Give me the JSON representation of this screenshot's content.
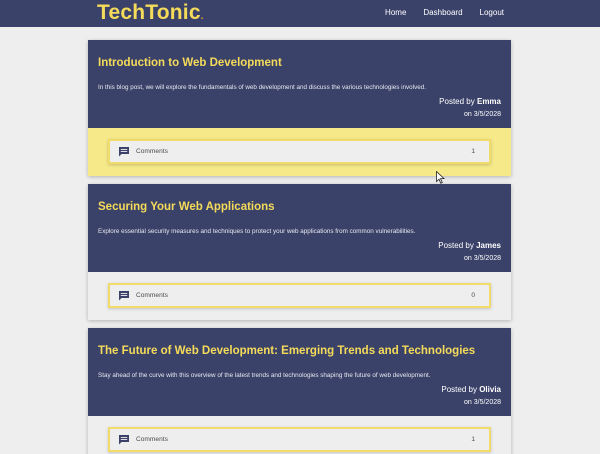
{
  "nav": {
    "brand": "TechTonic",
    "brand_dot": ".",
    "links": [
      "Home",
      "Dashboard",
      "Logout"
    ]
  },
  "posts": [
    {
      "title": "Introduction to Web Development",
      "description": "In this blog post, we will explore the fundamentals of web development and discuss the various technologies involved.",
      "posted_by_prefix": "Posted by",
      "author": "Emma",
      "date": "on 3/5/2028",
      "comments_label": "Comments",
      "comments_count": "1"
    },
    {
      "title": "Securing Your Web Applications",
      "description": "Explore essential security measures and techniques to protect your web applications from common vulnerabilities.",
      "posted_by_prefix": "Posted by",
      "author": "James",
      "date": "on 3/5/2028",
      "comments_label": "Comments",
      "comments_count": "0"
    },
    {
      "title": "The Future of Web Development: Emerging Trends and Technologies",
      "description": "Stay ahead of the curve with this overview of the latest trends and technologies shaping the future of web development.",
      "posted_by_prefix": "Posted by",
      "author": "Olivia",
      "date": "on 3/5/2028",
      "comments_label": "Comments",
      "comments_count": "1"
    }
  ],
  "colors": {
    "navy": "#3b4269",
    "accent_yellow": "#f5db5a",
    "highlight_yellow": "#f6e98a",
    "background": "#efeeef"
  },
  "icons": [
    "comment-icon"
  ]
}
